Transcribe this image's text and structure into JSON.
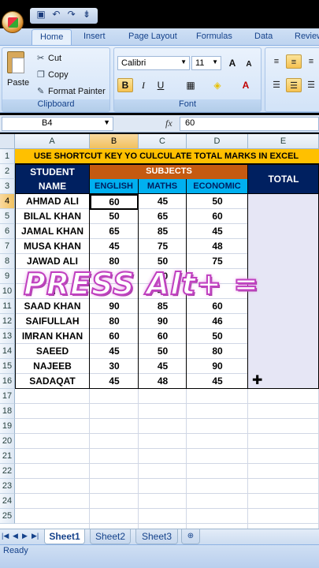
{
  "window": {
    "qat_icons": [
      "save-icon",
      "undo-icon",
      "redo-icon",
      "customize-icon"
    ],
    "qat_glyphs": [
      "▣",
      "↶",
      "↷",
      "⇟"
    ]
  },
  "tabs": [
    "Home",
    "Insert",
    "Page Layout",
    "Formulas",
    "Data",
    "Review"
  ],
  "active_tab": "Home",
  "ribbon": {
    "clipboard": {
      "paste": "Paste",
      "cut": "Cut",
      "copy": "Copy",
      "format_painter": "Format Painter",
      "group_label": "Clipboard"
    },
    "font": {
      "font_name": "Calibri",
      "font_size": "11",
      "bold": "B",
      "italic": "I",
      "underline": "U",
      "grow": "A",
      "shrink": "A",
      "group_label": "Font"
    }
  },
  "formula_bar": {
    "name_box": "B4",
    "fx": "fx",
    "formula": "60"
  },
  "columns": [
    "A",
    "B",
    "C",
    "D",
    "E"
  ],
  "rows": [
    "1",
    "2",
    "3",
    "4",
    "5",
    "6",
    "7",
    "8",
    "9",
    "10",
    "11",
    "12",
    "13",
    "14",
    "15",
    "16",
    "17",
    "18",
    "19",
    "20",
    "21",
    "22",
    "23",
    "24",
    "25"
  ],
  "sheet": {
    "title": "USE SHORTCUT KEY YO CULCULATE TOTAL MARKS IN EXCEL",
    "header_student": "STUDENT",
    "header_name": "NAME",
    "header_subjects": "SUBJECTS",
    "header_total": "TOTAL",
    "subjects": [
      "ENGLISH",
      "MATHS",
      "ECONOMIC"
    ],
    "students": [
      {
        "name": "AHMAD ALI",
        "english": "60",
        "maths": "45",
        "economic": "50"
      },
      {
        "name": "BILAL KHAN",
        "english": "50",
        "maths": "65",
        "economic": "60"
      },
      {
        "name": "JAMAL KHAN",
        "english": "65",
        "maths": "85",
        "economic": "45"
      },
      {
        "name": "MUSA KHAN",
        "english": "45",
        "maths": "75",
        "economic": "48"
      },
      {
        "name": "JAWAD ALI",
        "english": "80",
        "maths": "50",
        "economic": "75"
      },
      {
        "name": "",
        "english": "",
        "maths": "60",
        "economic": ""
      },
      {
        "name": "N",
        "english": "",
        "maths": "40",
        "economic": ""
      },
      {
        "name": "SAAD KHAN",
        "english": "90",
        "maths": "85",
        "economic": "60"
      },
      {
        "name": "SAIFULLAH",
        "english": "80",
        "maths": "90",
        "economic": "46"
      },
      {
        "name": "IMRAN KHAN",
        "english": "60",
        "maths": "60",
        "economic": "50"
      },
      {
        "name": "SAEED",
        "english": "45",
        "maths": "50",
        "economic": "80"
      },
      {
        "name": "NAJEEB",
        "english": "30",
        "maths": "45",
        "economic": "90"
      },
      {
        "name": "SADAQAT",
        "english": "45",
        "maths": "48",
        "economic": "45"
      }
    ]
  },
  "overlay_text": "PRESS  Alt+ =",
  "sheet_tabs": [
    "Sheet1",
    "Sheet2",
    "Sheet3"
  ],
  "active_sheet": "Sheet1",
  "status": "Ready"
}
